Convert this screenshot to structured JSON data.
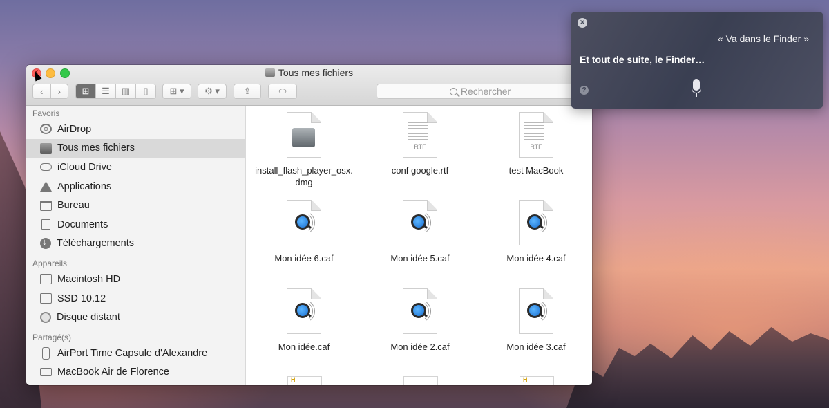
{
  "window": {
    "title": "Tous mes fichiers",
    "search_placeholder": "Rechercher"
  },
  "sidebar": {
    "favorites_title": "Favoris",
    "favorites": [
      {
        "label": "AirDrop",
        "icon": "airdrop-icon"
      },
      {
        "label": "Tous mes fichiers",
        "icon": "all-files-icon",
        "selected": true
      },
      {
        "label": "iCloud Drive",
        "icon": "cloud-icon"
      },
      {
        "label": "Applications",
        "icon": "applications-icon"
      },
      {
        "label": "Bureau",
        "icon": "desktop-icon"
      },
      {
        "label": "Documents",
        "icon": "documents-icon"
      },
      {
        "label": "Téléchargements",
        "icon": "download-icon"
      }
    ],
    "devices_title": "Appareils",
    "devices": [
      {
        "label": "Macintosh HD",
        "icon": "hard-drive-icon"
      },
      {
        "label": "SSD 10.12",
        "icon": "drive-icon"
      },
      {
        "label": "Disque distant",
        "icon": "remote-disc-icon"
      }
    ],
    "shared_title": "Partagé(s)",
    "shared": [
      {
        "label": "AirPort Time Capsule d'Alexandre",
        "icon": "time-capsule-icon"
      },
      {
        "label": "MacBook Air de Florence",
        "icon": "laptop-icon"
      }
    ]
  },
  "files": [
    {
      "name": "install_flash_player_osx.dmg",
      "type": "dmg",
      "rtf_tag": ""
    },
    {
      "name": "conf google.rtf",
      "type": "rtf",
      "rtf_tag": "RTF"
    },
    {
      "name": "test MacBook",
      "type": "rtf",
      "rtf_tag": "RTF"
    },
    {
      "name": "Mon idée 6.caf",
      "type": "caf",
      "rtf_tag": ""
    },
    {
      "name": "Mon idée 5.caf",
      "type": "caf",
      "rtf_tag": ""
    },
    {
      "name": "Mon idée 4.caf",
      "type": "caf",
      "rtf_tag": ""
    },
    {
      "name": "Mon idée.caf",
      "type": "caf",
      "rtf_tag": ""
    },
    {
      "name": "Mon idée 2.caf",
      "type": "caf",
      "rtf_tag": ""
    },
    {
      "name": "Mon idée 3.caf",
      "type": "caf",
      "rtf_tag": ""
    }
  ],
  "siri": {
    "query": "« Va dans le Finder »",
    "response": "Et tout de suite, le Finder…",
    "help": "?"
  }
}
